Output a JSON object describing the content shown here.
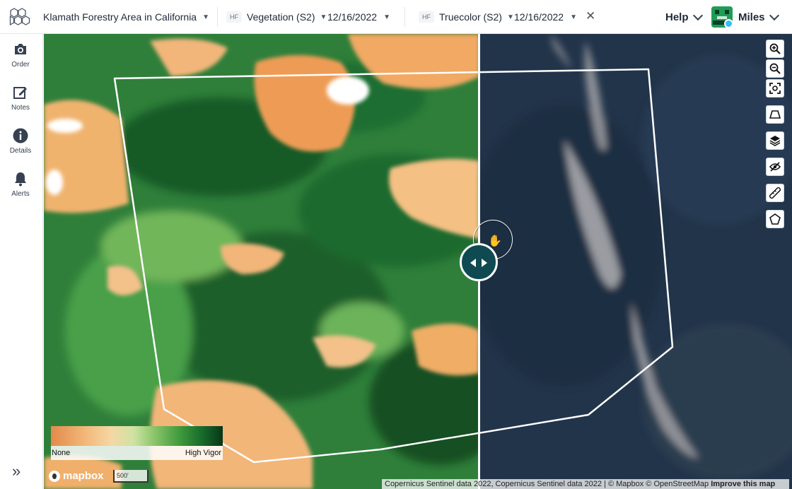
{
  "app": {
    "area_name": "Klamath Forestry Area in California"
  },
  "left_layer": {
    "badge": "HF",
    "name": "Vegetation (S2)",
    "date": "12/16/2022"
  },
  "right_layer": {
    "badge": "HF",
    "name": "Truecolor (S2)",
    "date": "12/16/2022"
  },
  "header": {
    "help_label": "Help",
    "user_name": "Miles"
  },
  "sidebar": {
    "items": [
      {
        "label": "Order",
        "icon": "camera-icon"
      },
      {
        "label": "Notes",
        "icon": "edit-icon"
      },
      {
        "label": "Details",
        "icon": "info-icon"
      },
      {
        "label": "Alerts",
        "icon": "bell-icon"
      }
    ],
    "expand_icon": "double-chevron-right-icon"
  },
  "toolbar": {
    "tools": [
      "zoom-in-icon",
      "zoom-out-icon",
      "fit-bounds-icon",
      "perspective-icon",
      "layers-icon",
      "hide-icon",
      "ruler-icon",
      "polygon-draw-icon"
    ]
  },
  "legend": {
    "min_label": "None",
    "max_label": "High Vigor"
  },
  "map": {
    "logo_text": "mapbox",
    "scale_label": "500'",
    "attribution": "Copernicus Sentinel data 2022, Copernicus Sentinel data 2022 | © Mapbox © OpenStreetMap",
    "improve_link": "Improve this map"
  },
  "colors": {
    "accent": "#0f4a52",
    "vegetation_high": "#083617",
    "vegetation_low": "#e38a4a"
  }
}
